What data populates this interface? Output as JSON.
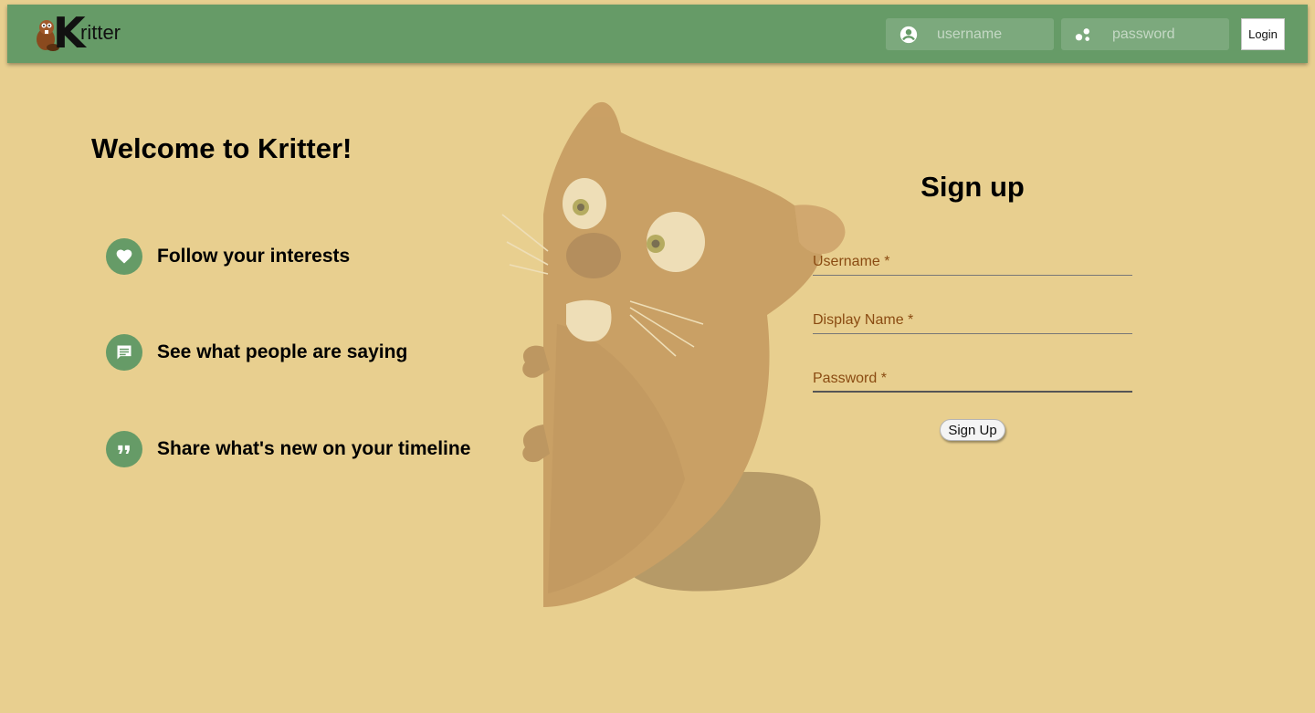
{
  "header": {
    "logo_text": "ritter",
    "logo_letter": "K",
    "username_placeholder": "username",
    "password_placeholder": "password",
    "login_label": "Login"
  },
  "intro": {
    "title": "Welcome to Kritter!",
    "features": [
      {
        "icon": "heart-icon",
        "label": "Follow your interests"
      },
      {
        "icon": "chat-icon",
        "label": "See what people are saying"
      },
      {
        "icon": "quote-icon",
        "label": "Share what's new on your timeline"
      }
    ]
  },
  "signup": {
    "title": "Sign up",
    "fields": [
      {
        "label": "Username *"
      },
      {
        "label": "Display Name *"
      },
      {
        "label": "Password *"
      }
    ],
    "button_label": "Sign Up"
  },
  "colors": {
    "background": "#e8cf8f",
    "header": "#669b67",
    "accent": "#669b67",
    "field_label": "#8a4b12"
  }
}
